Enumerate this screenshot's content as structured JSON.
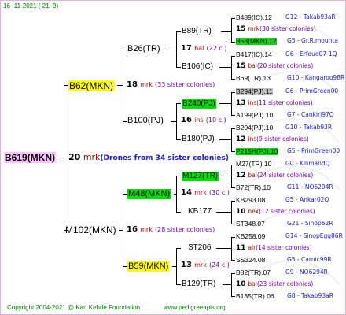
{
  "date": "16- 11-2021 ( 21: 9)",
  "root": {
    "name": "B619(MKN)",
    "num": "20",
    "abbr": "mrk",
    "note": "(Drones from 34 sister colonies)"
  },
  "g1": [
    {
      "name": "B62(MKN)",
      "num": "18",
      "abbr": "mrk",
      "note": "(33 sister colonies)"
    },
    {
      "name": "M102(MKN)",
      "num": "16",
      "abbr": "mrk",
      "note": "(28 sister colonies)"
    }
  ],
  "g2": [
    {
      "name": "B26(TR)",
      "num": "17",
      "abbr": "bal",
      "note": "(22 c.)"
    },
    {
      "name": "B100(PJ)",
      "num": "16",
      "abbr": "ins",
      "note": "(10 c.)"
    },
    {
      "name": "M48(MKN)",
      "num": "14",
      "abbr": "mrk",
      "note": "(30 c.)"
    },
    {
      "name": "B59(MKN)",
      "num": "13",
      "abbr": "mrk",
      "note": "(24 c.)"
    }
  ],
  "g3": [
    {
      "name": "B89(TR)"
    },
    {
      "name": "B106(IC)"
    },
    {
      "name": "B240(PJ)"
    },
    {
      "name": "B180(PJ)"
    },
    {
      "name": "M127(TR)"
    },
    {
      "name": "KB177"
    },
    {
      "name": "ST206"
    },
    {
      "name": "B129(TR)"
    }
  ],
  "g4": [
    {
      "top": "B489(IC).12",
      "top_r": "G12 - Takab93aR",
      "num": "15",
      "abbr": "mrk",
      "note": "(30 sister colonies)",
      "bot": "B53(MKN).12",
      "bot_r": "G5 - Gr.R.mounta"
    },
    {
      "top": "B417(IC).14",
      "top_r": "G6 - Erfoud07-1Q",
      "num": "15",
      "abbr": "bal",
      "note": "(20 sister colonies)",
      "bot": "B69(TR).13",
      "bot_r": "G10 - Kangaroo98R"
    },
    {
      "top": "B294(PJ).11",
      "top_r": "G6 - PrimGreen00",
      "num": "13",
      "abbr": "ins",
      "note": "(11 sister colonies)",
      "bot": "A199(PJ).10",
      "bot_r": "G7 - Cankiri97Q"
    },
    {
      "top": "B204(PJ).10",
      "top_r": "G10 - Takab93R",
      "num": "12",
      "abbr": "ins",
      "note": "(9 sister colonies)",
      "bot": "P215H(PJ).10",
      "bot_r": "G5 - PrimGreen00"
    },
    {
      "top": "M27(TR).10",
      "top_r": "G0 - KilimandQ",
      "num": "12",
      "abbr": "bal",
      "note": "(24 sister colonies)",
      "bot": "B72(TR).10",
      "bot_r": "G11 - NO6294R"
    },
    {
      "top": "KB293.08",
      "top_r": "G5 - Ankar02Q",
      "num": "10",
      "abbr": "nex",
      "note": "(12 sister colonies)",
      "bot": "ST348.07",
      "bot_r": "G21 - Sinop62R"
    },
    {
      "top": "KB258.09",
      "top_r": "G14 - SinopEgg86R",
      "num": "11",
      "abbr": "alr",
      "note": "(14 sister colonies)",
      "bot": "SS324.08",
      "bot_r": "G5 - Carnic99R"
    },
    {
      "top": "B82(TR).07",
      "top_r": "G9 - NO6294R",
      "num": "10",
      "abbr": "bal",
      "note": "(23 sister colonies)",
      "bot": "B135(TR).06",
      "bot_r": "G8 - Takab93aR"
    }
  ],
  "footer": {
    "copyright": "Copyright 2004-2021 @ Karl Kehrle Foundation",
    "url": "www.pedigreeapis.org"
  }
}
